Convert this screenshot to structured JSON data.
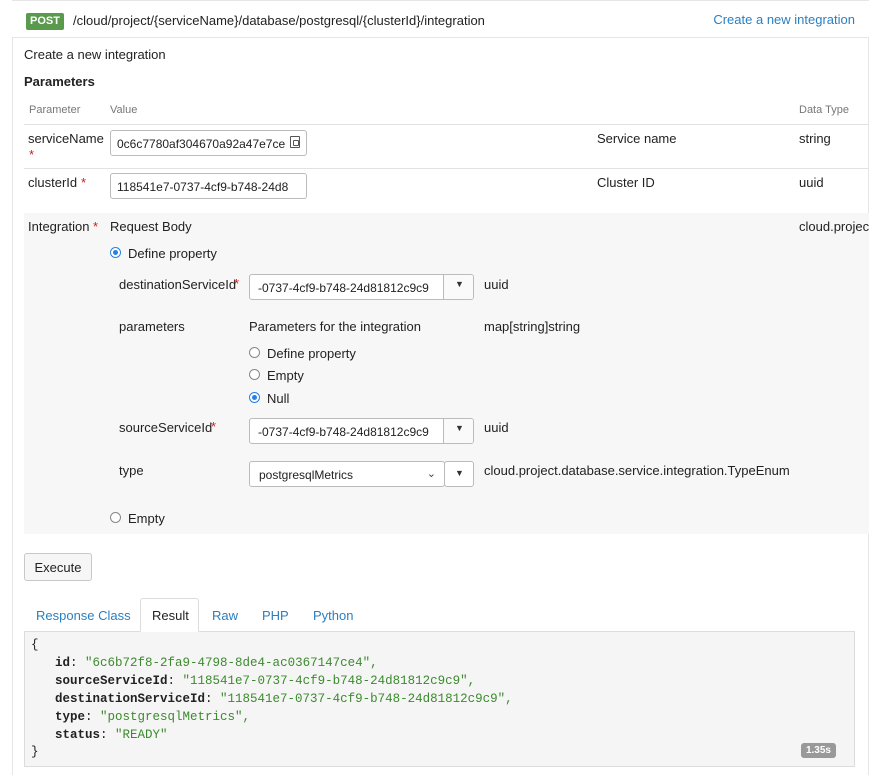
{
  "operation": {
    "method": "POST",
    "path": "/cloud/project/{serviceName}/database/postgresql/{clusterId}/integration",
    "summary_link": "Create a new integration",
    "description": "Create a new integration"
  },
  "parameters": {
    "title": "Parameters",
    "columns": {
      "parameter": "Parameter",
      "value": "Value",
      "description": "",
      "data_type": "Data Type"
    },
    "service_name": {
      "name": "serviceName",
      "required": "*",
      "value": "0c6c7780af304670a92a47e7ce",
      "description": "Service name",
      "type": "string"
    },
    "cluster_id": {
      "name": "clusterId",
      "required": "*",
      "value": "118541e7-0737-4cf9-b748-24d8",
      "description": "Cluster ID",
      "type": "uuid"
    },
    "integration": {
      "name": "Integration",
      "required": "*",
      "description": "Request Body",
      "type": "cloud.projec",
      "define_property_label": "Define property",
      "empty_label": "Empty",
      "fields": {
        "destination": {
          "name": "destinationServiceId",
          "required": "*",
          "value": "-0737-4cf9-b748-24d81812c9c9",
          "type": "uuid"
        },
        "parameters": {
          "name": "parameters",
          "description": "Parameters for the integration",
          "type": "map[string]string",
          "options": [
            "Define property",
            "Empty",
            "Null"
          ],
          "selected": "Null"
        },
        "source": {
          "name": "sourceServiceId",
          "required": "*",
          "value": "-0737-4cf9-b748-24d81812c9c9",
          "type": "uuid"
        },
        "type": {
          "name": "type",
          "value": "postgresqlMetrics",
          "type": "cloud.project.database.service.integration.TypeEnum"
        }
      }
    }
  },
  "execute_label": "Execute",
  "tabs": [
    "Response Class",
    "Result",
    "Raw",
    "PHP",
    "Python"
  ],
  "active_tab": "Result",
  "result": {
    "open": "{",
    "close": "}",
    "lines": [
      {
        "key": "id",
        "value": "\"6c6b72f8-2fa9-4798-8de4-ac0367147ce4\","
      },
      {
        "key": "sourceServiceId",
        "value": "\"118541e7-0737-4cf9-b748-24d81812c9c9\","
      },
      {
        "key": "destinationServiceId",
        "value": "\"118541e7-0737-4cf9-b748-24d81812c9c9\","
      },
      {
        "key": "type",
        "value": "\"postgresqlMetrics\","
      },
      {
        "key": "status",
        "value": "\"READY\""
      }
    ],
    "timing": "1.35s"
  },
  "colors": {
    "accent": "#2a7fc1",
    "post_badge": "#5a9a4d",
    "string": "#3c8a2e",
    "required": "#d21919"
  }
}
